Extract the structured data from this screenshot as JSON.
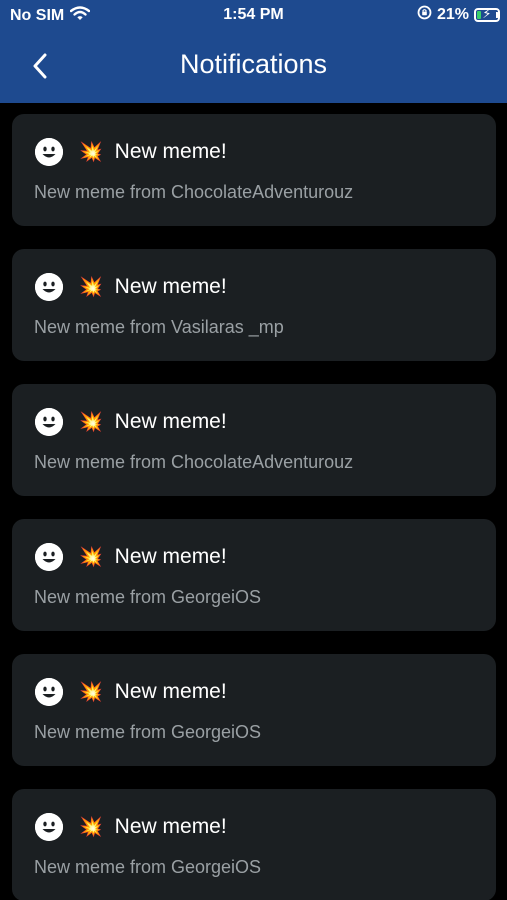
{
  "status_bar": {
    "carrier": "No SIM",
    "time": "1:54 PM",
    "battery_percent": "21%",
    "battery_level": 0.21
  },
  "nav": {
    "title": "Notifications"
  },
  "notifications": [
    {
      "title": "New meme!",
      "emoji": "💥",
      "body": "New meme from ChocolateAdventurouz"
    },
    {
      "title": "New meme!",
      "emoji": "💥",
      "body": "New meme from Vasilaras _mp"
    },
    {
      "title": "New meme!",
      "emoji": "💥",
      "body": "New meme from ChocolateAdventurouz"
    },
    {
      "title": "New meme!",
      "emoji": "💥",
      "body": "New meme from GeorgeiOS"
    },
    {
      "title": "New meme!",
      "emoji": "💥",
      "body": "New meme from GeorgeiOS"
    },
    {
      "title": "New meme!",
      "emoji": "💥",
      "body": "New meme from GeorgeiOS"
    }
  ],
  "colors": {
    "header_bg": "#1e4a8f",
    "card_bg": "#1b1f22",
    "body_text": "#9aa0a4",
    "battery_fill": "#38d16a"
  }
}
